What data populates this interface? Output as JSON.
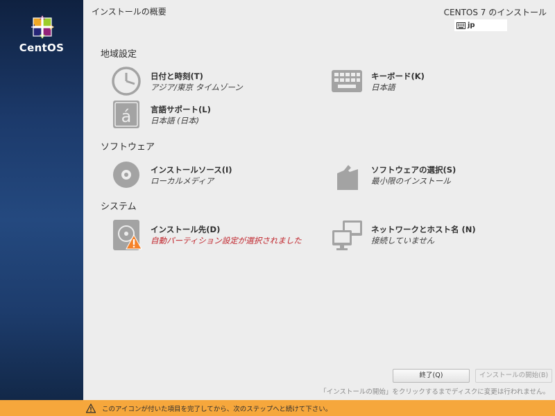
{
  "sidebar": {
    "brand": "CentOS"
  },
  "header": {
    "page_title": "インストールの概要",
    "product_title": "CENTOS 7 のインストール",
    "keyboard_layout": "jp"
  },
  "sections": {
    "localization": {
      "title": "地域設定",
      "datetime": {
        "title": "日付と時刻(T)",
        "status": "アジア/東京 タイムゾーン"
      },
      "keyboard": {
        "title": "キーボード(K)",
        "status": "日本語"
      },
      "language": {
        "title": "言語サポート(L)",
        "status": "日本語 (日本)"
      }
    },
    "software": {
      "title": "ソフトウェア",
      "source": {
        "title": "インストールソース(I)",
        "status": "ローカルメディア"
      },
      "selection": {
        "title": "ソフトウェアの選択(S)",
        "status": "最小限のインストール"
      }
    },
    "system": {
      "title": "システム",
      "destination": {
        "title": "インストール先(D)",
        "status": "自動パーティション設定が選択されました"
      },
      "network": {
        "title": "ネットワークとホスト名 (N)",
        "status": "接続していません"
      }
    }
  },
  "buttons": {
    "quit": "終了(Q)",
    "begin": "インストールの開始(B)"
  },
  "hint": "「インストールの開始」をクリックするまでディスクに変更は行われません。",
  "warning": "このアイコンが付いた項目を完了してから、次のステップへと続けて下さい。",
  "colors": {
    "sidebar": "#1c3a6b",
    "warning_bar": "#f6a73c",
    "warning_text": "#c0242b",
    "icon_gray": "#a3a3a3"
  }
}
